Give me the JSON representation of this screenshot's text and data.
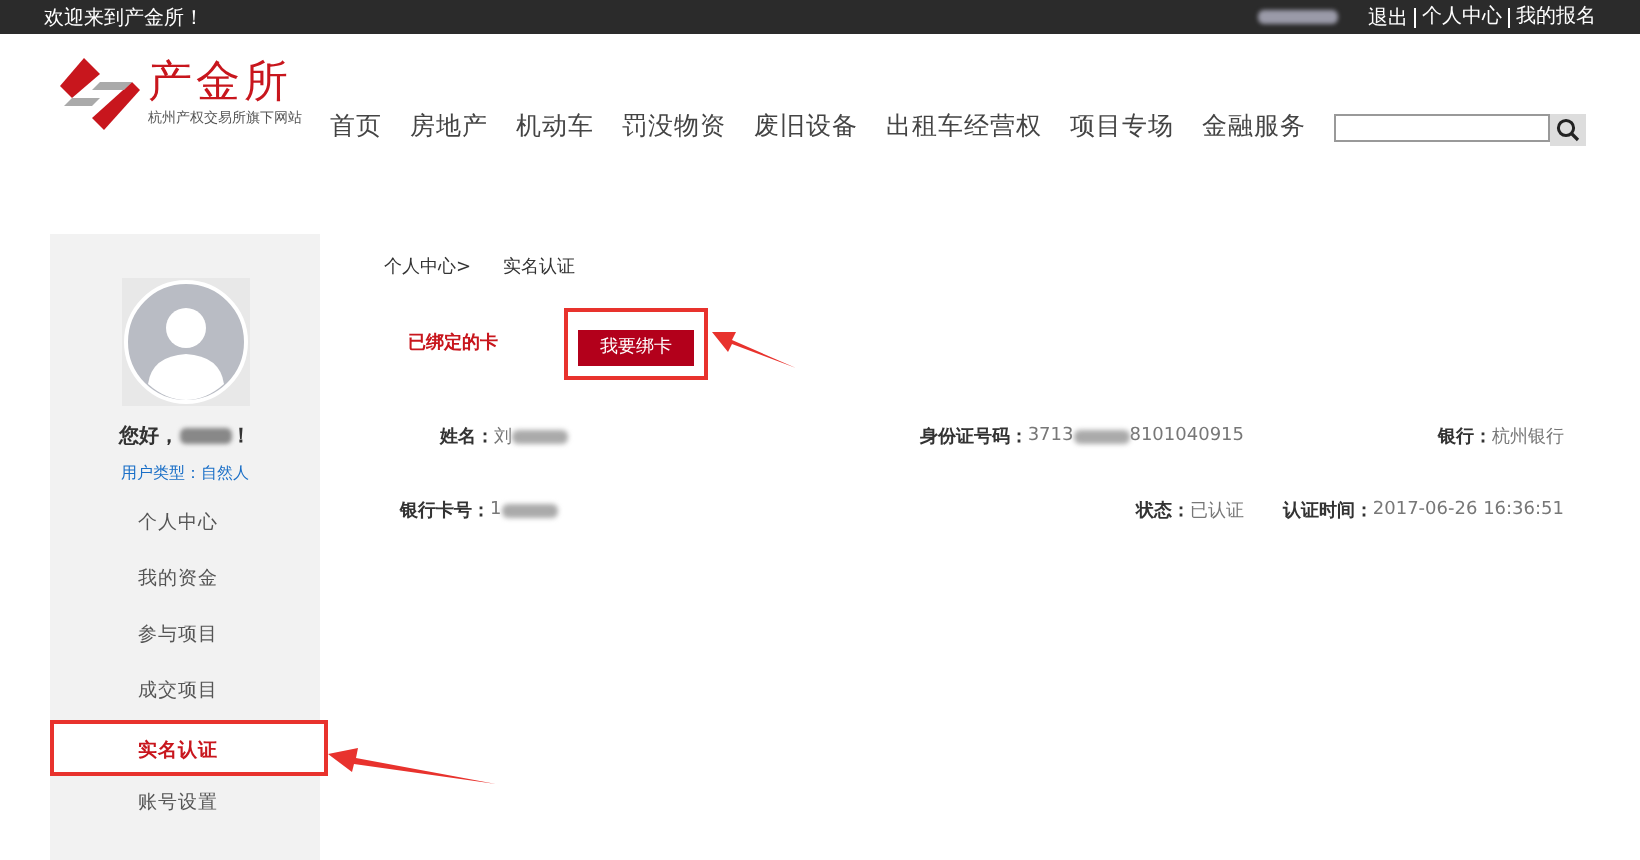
{
  "top_bar": {
    "welcome": "欢迎来到产金所！",
    "links": [
      "退出",
      "个人中心",
      "我的报名"
    ]
  },
  "logo": {
    "name": "产金所",
    "subtitle": "杭州产权交易所旗下网站"
  },
  "nav": [
    "首页",
    "房地产",
    "机动车",
    "罚没物资",
    "废旧设备",
    "出租车经营权",
    "项目专场",
    "金融服务"
  ],
  "sidebar": {
    "greeting_prefix": "您好，",
    "greeting_suffix": "！",
    "user_type_label": "用户类型：",
    "user_type": "自然人",
    "items": [
      {
        "label": "个人中心",
        "selected": false
      },
      {
        "label": "我的资金",
        "selected": false
      },
      {
        "label": "参与项目",
        "selected": false
      },
      {
        "label": "成交项目",
        "selected": false
      },
      {
        "label": "实名认证",
        "selected": true
      },
      {
        "label": "账号设置",
        "selected": false
      }
    ]
  },
  "breadcrumb": [
    "个人中心>",
    "实名认证"
  ],
  "card_section": {
    "title": "已绑定的卡",
    "button": "我要绑卡"
  },
  "fields": [
    {
      "label": "姓名：",
      "value": "刘",
      "blurred": true
    },
    {
      "label": "身份证号码：",
      "value": "3713",
      "blurred": true,
      "suffix": "8101040915"
    },
    {
      "label": "银行：",
      "value": "杭州银行",
      "blurred": false
    },
    {
      "label": "银行卡号：",
      "value": "1",
      "blurred": true
    },
    {
      "label": "状态：",
      "value": "已认证",
      "blurred": false
    },
    {
      "label": "认证时间：",
      "value": "2017-06-26 16:36:51",
      "blurred": false
    }
  ]
}
